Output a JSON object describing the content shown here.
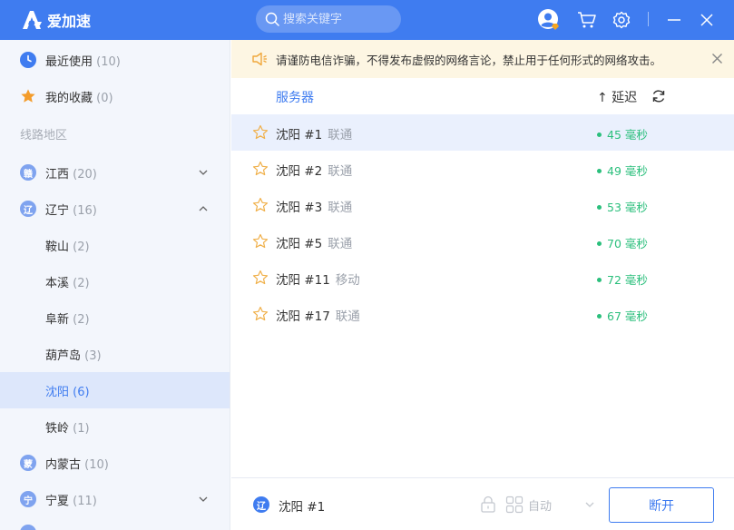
{
  "app": {
    "title": "爱加速"
  },
  "search": {
    "placeholder": "搜索关键字"
  },
  "colors": {
    "primary": "#3f7cf0",
    "latency_good": "#2bbf7c",
    "notice_bg": "#fdf6e3"
  },
  "titlebar_icons": [
    "user-avatar-icon",
    "cart-icon",
    "gear-icon",
    "minimize-icon",
    "close-icon"
  ],
  "sidebar": {
    "recent": {
      "label": "最近使用",
      "count": "(10)"
    },
    "favorites": {
      "label": "我的收藏",
      "count": "(0)"
    },
    "section_title": "线路地区",
    "regions": [
      {
        "badge": "赣",
        "label": "江西",
        "count": "(20)",
        "expanded": false
      },
      {
        "badge": "辽",
        "label": "辽宁",
        "count": "(16)",
        "expanded": true
      },
      {
        "badge": "蒙",
        "label": "内蒙古",
        "count": "(10)",
        "expanded": false
      },
      {
        "badge": "宁",
        "label": "宁夏",
        "count": "(11)",
        "expanded": false
      }
    ],
    "cities": [
      {
        "label": "鞍山",
        "count": "(2)"
      },
      {
        "label": "本溪",
        "count": "(2)"
      },
      {
        "label": "阜新",
        "count": "(2)"
      },
      {
        "label": "葫芦岛",
        "count": "(3)"
      },
      {
        "label": "沈阳",
        "count": "(6)",
        "active": true
      },
      {
        "label": "铁岭",
        "count": "(1)"
      }
    ]
  },
  "notice": {
    "text": "请谨防电信诈骗，不得发布虚假的网络言论，禁止用于任何形式的网络攻击。"
  },
  "list_header": {
    "server": "服务器",
    "latency": "↑ 延迟"
  },
  "servers": [
    {
      "name": "沈阳 #1",
      "isp": "联通",
      "latency": "45 毫秒",
      "selected": true
    },
    {
      "name": "沈阳 #2",
      "isp": "联通",
      "latency": "49 毫秒"
    },
    {
      "name": "沈阳 #3",
      "isp": "联通",
      "latency": "53 毫秒"
    },
    {
      "name": "沈阳 #5",
      "isp": "联通",
      "latency": "70 毫秒"
    },
    {
      "name": "沈阳 #11",
      "isp": "移动",
      "latency": "72 毫秒"
    },
    {
      "name": "沈阳 #17",
      "isp": "联通",
      "latency": "67 毫秒"
    }
  ],
  "footer": {
    "current_badge": "辽",
    "current_server": "沈阳 #1",
    "mode": "自动",
    "disconnect": "断开"
  }
}
